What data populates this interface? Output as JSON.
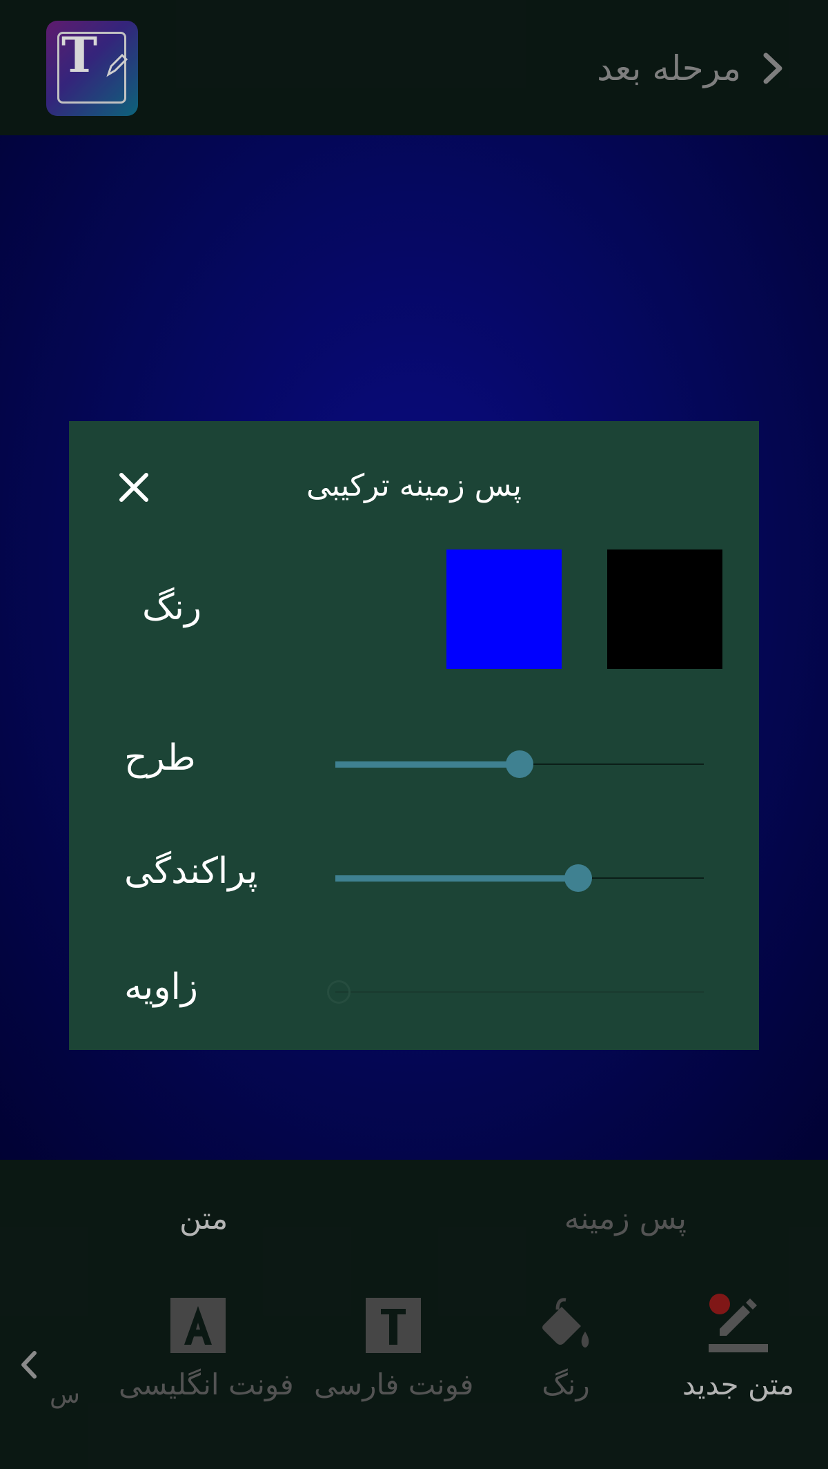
{
  "header": {
    "app_icon": "text-edit-app-icon",
    "app_icon_letter": "T",
    "next_step_label": "مرحله بعد",
    "next_icon": "chevron-right-icon"
  },
  "dialog": {
    "title": "پس زمینه ترکیبی",
    "close_icon": "close-icon",
    "color_label": "رنگ",
    "swatches": [
      {
        "name": "color-1",
        "color": "#0000ff"
      },
      {
        "name": "color-2",
        "color": "#000000"
      }
    ],
    "pattern_label": "طرح",
    "pattern_value": 0.5,
    "spread_label": "پراکندگی",
    "spread_value": 0.66,
    "angle_label": "زاویه",
    "angle_value": 0,
    "angle_enabled": false
  },
  "bottom_tabs": {
    "text": "متن",
    "background": "پس زمینه"
  },
  "tools": [
    {
      "label": "متن جدید",
      "icon": "pencil-icon",
      "active": true
    },
    {
      "label": "رنگ",
      "icon": "paint-bucket-icon",
      "active": false
    },
    {
      "label": "فونت فارسی",
      "icon": "persian-font-icon",
      "active": false
    },
    {
      "label": "فونت انگلیسی",
      "icon": "english-font-icon",
      "active": false
    }
  ],
  "tools_partial_label": "س",
  "tools_scroll_icon": "chevron-left-icon",
  "colors": {
    "accent": "#3f8191",
    "dialog_bg": "#1c4436",
    "notification_dot": "#8f1a1a"
  }
}
